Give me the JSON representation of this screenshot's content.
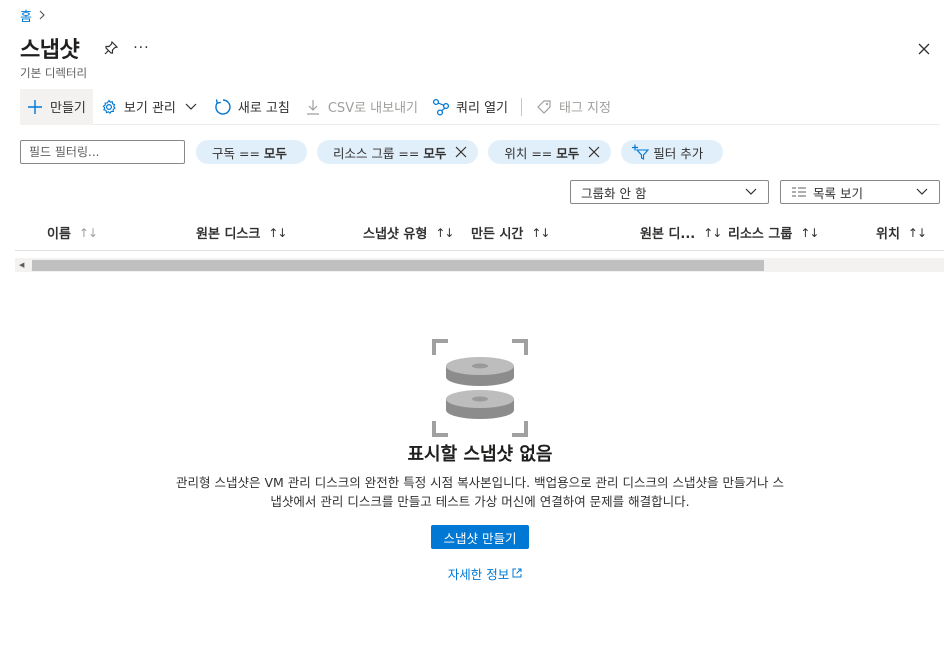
{
  "breadcrumb": {
    "home": "홈",
    "separator": ">"
  },
  "header": {
    "title": "스냅샷",
    "subtitle": "기본 디렉터리",
    "more": "···"
  },
  "toolbar": {
    "create": "만들기",
    "manage_view": "보기 관리",
    "refresh": "새로 고침",
    "export_csv": "CSV로 내보내기",
    "open_query": "쿼리 열기",
    "assign_tags": "태그 지정"
  },
  "filters": {
    "placeholder": "필드 필터링...",
    "subscription": {
      "label": "구독 ==",
      "value": "모두"
    },
    "resource_group": {
      "label": "리소스 그룹 ==",
      "value": "모두"
    },
    "location": {
      "label": "위치 ==",
      "value": "모두"
    },
    "add_filter": "필터 추가"
  },
  "grouping": {
    "selected": "그룹화 안 함"
  },
  "view_mode": {
    "selected": "목록 보기"
  },
  "table": {
    "columns": [
      {
        "label": "이름",
        "sort": "↑↓"
      },
      {
        "label": "원본 디스크",
        "sort": "↑↓"
      },
      {
        "label": "스냅샷 유형",
        "sort": "↑↓"
      },
      {
        "label": "만든 시간",
        "sort": "↑↓"
      },
      {
        "label": "원본 디...",
        "sort": "↑↓"
      },
      {
        "label": "리소스 그룹",
        "sort": "↑↓"
      },
      {
        "label": "위치",
        "sort": "↑↓"
      }
    ]
  },
  "empty_state": {
    "title": "표시할 스냅샷 없음",
    "description_line1": "관리형 스냅샷은 VM 관리 디스크의 완전한 특정 시점 복사본입니다. 백업용으로 관리 디스크의 스냅샷을 만들거나 스",
    "description_line2": "냅샷에서 관리 디스크를 만들고 테스트 가상 머신에 연결하여 문제를 해결합니다.",
    "create_button": "스냅샷 만들기",
    "learn_more": "자세한 정보"
  },
  "colors": {
    "accent": "#0078d4",
    "pill_bg": "#e1effa"
  }
}
